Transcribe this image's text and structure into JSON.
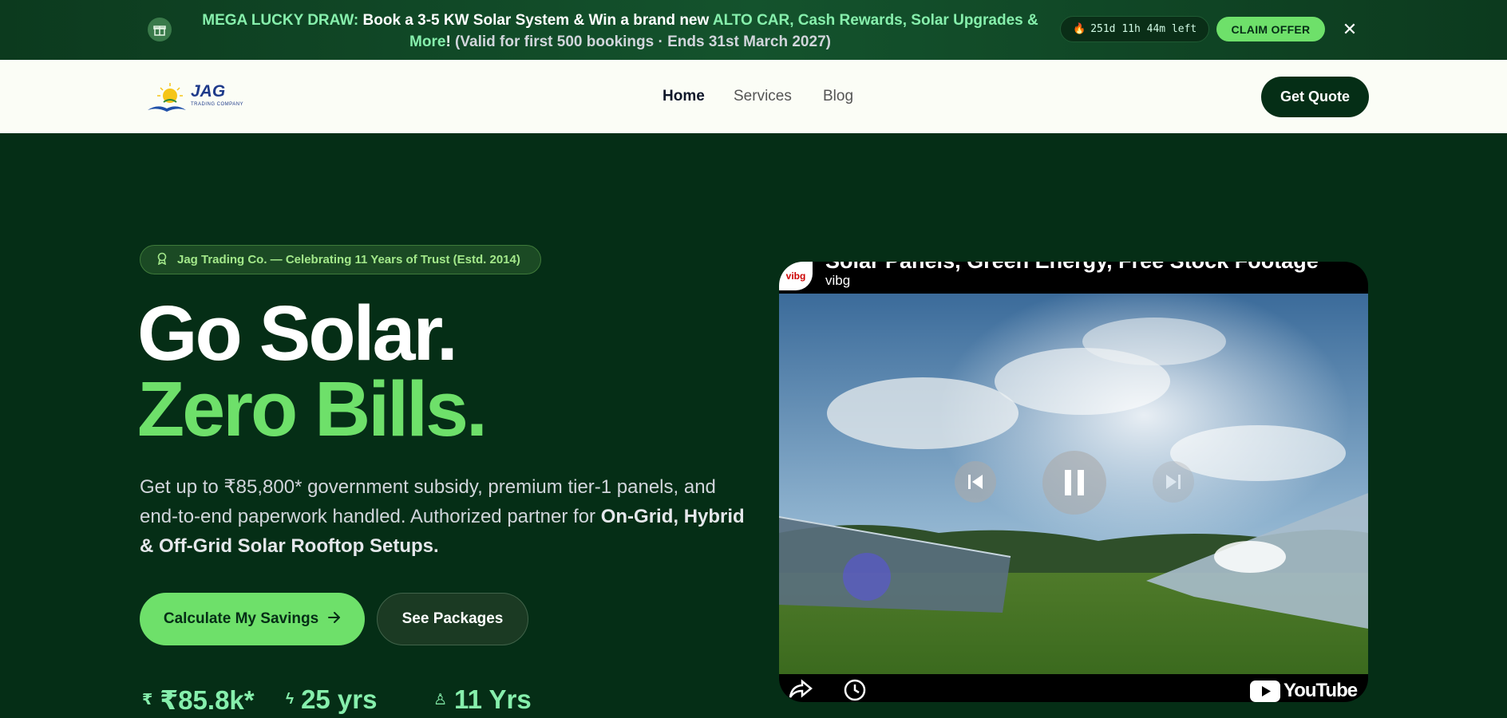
{
  "promo": {
    "lead": "MEGA LUCKY DRAW:",
    "text1": " Book a 3-5 KW Solar System & Win a brand new ",
    "highlight": "ALTO CAR, Cash Rewards, Solar Upgrades & More",
    "text2": "!",
    "note": "(Valid for first 500 bookings · Ends 31st March 2027)",
    "countdown": "251d 11h 44m left",
    "claim_label": "CLAIM OFFER",
    "close": "✕"
  },
  "nav": {
    "brand": "JAG",
    "brand_sub": "TRADING COMPANY",
    "links": [
      "Home",
      "Services",
      "Blog"
    ],
    "cta": "Get Quote"
  },
  "hero": {
    "trust_badge": "Jag Trading Co. — Celebrating 11 Years of Trust (Estd. 2014)",
    "headline_line1": "Go Solar.",
    "headline_line2": "Zero Bills.",
    "lead_text": "Get up to ₹85,800* government subsidy, premium tier-1 panels, and end-to-end paperwork handled. Authorized partner for ",
    "lead_bold": "On-Grid, Hybrid & Off-Grid Solar Rooftop Setups.",
    "primary_cta": "Calculate My Savings",
    "secondary_cta": "See Packages",
    "stats": [
      {
        "icon": "₹",
        "value": "₹85.8k*"
      },
      {
        "icon": "ϟ",
        "value": "25 yrs"
      },
      {
        "icon": "♙",
        "value": "11 Yrs"
      }
    ]
  },
  "video": {
    "title": "Solar Panels, Green Energy, Free Stock Footage",
    "channel": "vibg",
    "avatar": "vibg",
    "brand": "YouTube"
  },
  "colors": {
    "bg": "#052e16",
    "accent": "#6ee06a",
    "nav_bg": "#fbfdf6"
  }
}
